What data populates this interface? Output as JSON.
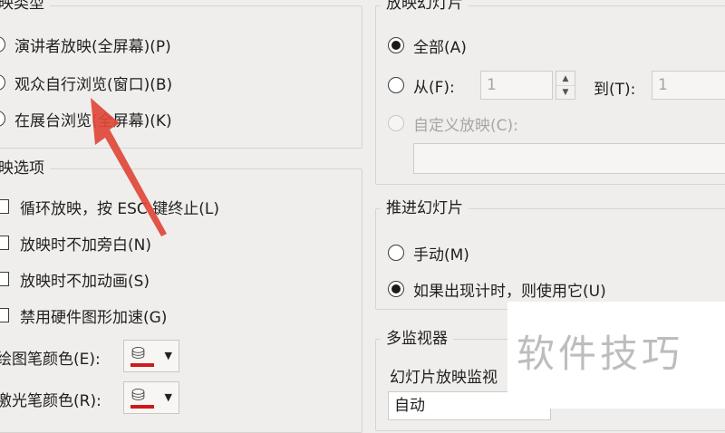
{
  "left": {
    "show_type": {
      "legend": "映类型",
      "options": [
        {
          "label": "演讲者放映(全屏幕)(P)",
          "selected": false
        },
        {
          "label": "观众自行浏览(窗口)(B)",
          "selected": false
        },
        {
          "label": "在展台浏览(全屏幕)(K)",
          "selected": false
        }
      ]
    },
    "show_options": {
      "legend": "映选项",
      "items": [
        {
          "label": "循环放映，按 ESC 键终止(L)",
          "checked": false
        },
        {
          "label": "放映时不加旁白(N)",
          "checked": false
        },
        {
          "label": "放映时不加动画(S)",
          "checked": false
        },
        {
          "label": "禁用硬件图形加速(G)",
          "checked": false
        }
      ]
    },
    "pen_color_label": "绘图笔颜色(E):",
    "laser_color_label": "激光笔颜色(R):"
  },
  "right": {
    "slides": {
      "legend": "放映幻灯片",
      "all_label": "全部(A)",
      "from_label": "从(F):",
      "from_value": "1",
      "to_label": "到(T):",
      "to_value": "1",
      "custom_label": "自定义放映(C):"
    },
    "advance": {
      "legend": "推进幻灯片",
      "manual_label": "手动(M)",
      "timing_label": "如果出现计时，则使用它(U)"
    },
    "monitors": {
      "legend": "多监视器",
      "monitor_label": "幻灯片放映监视",
      "monitor_value": "自动"
    }
  },
  "watermark": "软件技巧",
  "colors": {
    "background": "#f0eeec",
    "pen_color": "#d0191b",
    "annotation_arrow": "#e0463a"
  }
}
